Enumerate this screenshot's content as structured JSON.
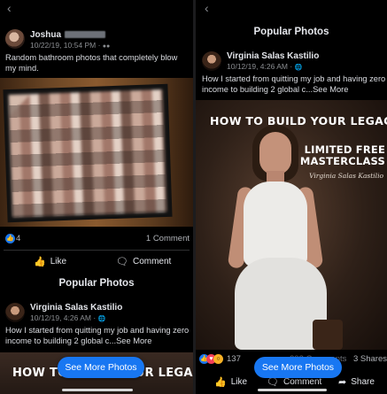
{
  "left": {
    "post": {
      "author": "Joshua",
      "timestamp": "10/22/19, 10:54 PM",
      "privacy_icon": "friends-icon",
      "text": "Random bathroom photos that completely blow my mind.",
      "reactions_count": "4",
      "comments_count": "1 Comment"
    },
    "actions": {
      "like": "Like",
      "comment": "Comment"
    },
    "section_title": "Popular Photos",
    "related_post": {
      "author": "Virginia Salas Kastilio",
      "timestamp": "10/12/19, 4:26 AM",
      "text": "How I started from quitting my job and having zero income to building 2 global c...",
      "see_more": "See More"
    },
    "banner_title": "HOW TO BUILD YOUR LEGACY",
    "see_more_photos": "See More Photos"
  },
  "right": {
    "section_title": "Popular Photos",
    "post": {
      "author": "Virginia Salas Kastilio",
      "timestamp": "10/12/19, 4:26 AM",
      "text": "How I started from quitting my job and having zero income to building 2 global c...",
      "see_more": "See More",
      "hero_title": "HOW TO BUILD YOUR LEGACY",
      "hero_subtitle_1": "LIMITED FREE",
      "hero_subtitle_2": "MASTERCLASS",
      "hero_signature": "Virginia Salas Kastilio",
      "reactions_count": "137",
      "comments_count": "202 Comments",
      "shares_count": "3 Shares"
    },
    "actions": {
      "like": "Like",
      "comment": "Comment",
      "share": "Share"
    },
    "see_more_photos": "See More Photos"
  },
  "colors": {
    "accent": "#1877f2",
    "background": "#000000",
    "text": "#e4e6eb",
    "muted": "#8a8d91"
  }
}
